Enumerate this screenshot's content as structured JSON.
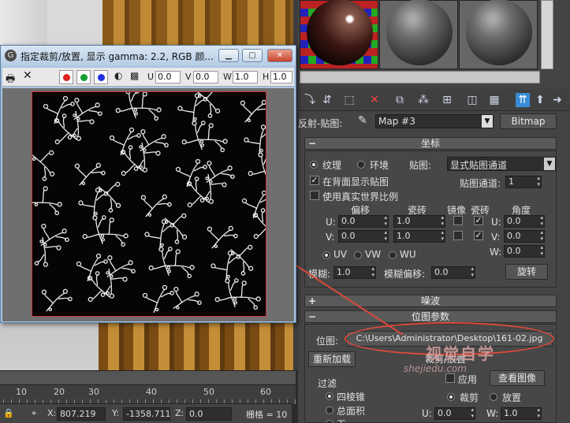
{
  "viewport": {
    "ruler_numbers": [
      "10",
      "20",
      "30",
      "40",
      "50",
      "60"
    ],
    "status": {
      "x_label": "X:",
      "x_value": "807.219",
      "y_label": "Y:",
      "y_value": "-1358.711",
      "z_label": "Z:",
      "z_value": "0.0",
      "grid_label": "栅格 = 10"
    }
  },
  "image_window": {
    "title": "指定裁剪/放置, 显示 gamma: 2.2, RGB 颜...",
    "toolbar": {
      "colors": [
        "#e02020",
        "#10a030",
        "#2030e0"
      ],
      "u_label": "U",
      "u_value": "0.0",
      "v_label": "V",
      "v_value": "0.0",
      "w_label": "W",
      "w_value": "1.0",
      "h_label": "H",
      "h_value": "1.0"
    }
  },
  "material_editor": {
    "map_label": "反射-贴图:",
    "map_name": "Map #3",
    "map_type": "Bitmap",
    "coords": {
      "title": "坐标",
      "texture": "纹理",
      "environ": "环境",
      "mapping_label": "贴图:",
      "mapping_value": "显式贴图通道",
      "show_back": "在背面显示贴图",
      "channel_label": "贴图通道:",
      "channel_value": "1",
      "real_world": "使用真实世界比例",
      "offset_hdr": "偏移",
      "tiling_hdr": "瓷砖",
      "mirror_hdr": "镜像",
      "tile_hdr": "瓷砖",
      "angle_hdr": "角度",
      "u_label": "U:",
      "v_label": "V:",
      "w_label": "W:",
      "u_offset": "0.0",
      "v_offset": "0.0",
      "u_tiling": "1.0",
      "v_tiling": "1.0",
      "u_angle": "0.0",
      "v_angle": "0.0",
      "w_angle": "0.0",
      "uv": "UV",
      "vw": "VW",
      "wu": "WU",
      "blur_label": "模糊:",
      "blur_value": "1.0",
      "blur_offset_label": "模糊偏移:",
      "blur_offset_value": "0.0",
      "rotate_button": "旋转"
    },
    "noise": {
      "title": "噪波"
    },
    "bitmap_params": {
      "title": "位图参数",
      "bitmap_label": "位图:",
      "bitmap_path": "C:\\Users\\Administrator\\Desktop\\161-02.jpg",
      "reload_button": "重新加载",
      "crop_title": "裁剪/放置",
      "apply_label": "应用",
      "view_image_button": "查看图像",
      "crop_label": "裁剪",
      "place_label": "放置",
      "filter_title": "过滤",
      "filter_pyramid": "四棱锥",
      "filter_sat": "总面积",
      "filter_none": "无",
      "u_label": "U:",
      "u_value": "0.0",
      "w_label": "W:",
      "w_value": "1.0"
    }
  },
  "watermark": {
    "logo": "视觉自学",
    "url": "shejiedu.com"
  }
}
